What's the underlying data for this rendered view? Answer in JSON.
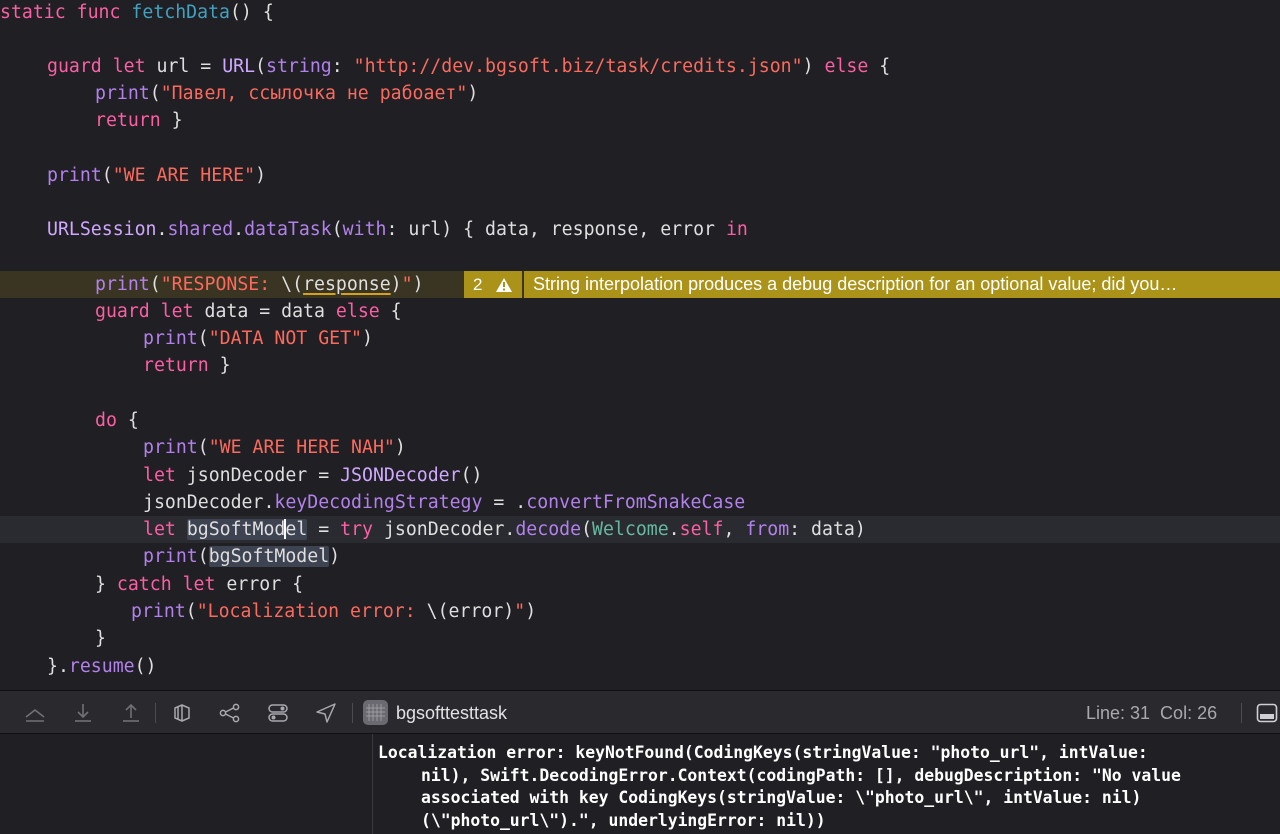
{
  "editor": {
    "lines": {
      "l1": {
        "kw1": "static",
        "kw2": "func",
        "name": "fetchData",
        "rest": "() {"
      },
      "l2": {
        "kw1": "guard",
        "kw2": "let",
        "mid": " url = ",
        "type": "URL",
        "p1": "(",
        "label": "string",
        "p2": ": ",
        "str": "\"http://dev.bgsoft.biz/task/credits.json\"",
        "p3": ") ",
        "kw3": "else",
        "p4": " {"
      },
      "l3": {
        "fn": "print",
        "p1": "(",
        "str": "\"Павел, ссылочка не рабоает\"",
        "p2": ")"
      },
      "l4": {
        "kw": "return",
        "rest": " }"
      },
      "l5": {
        "fn": "print",
        "p1": "(",
        "str": "\"WE ARE HERE\"",
        "p2": ")"
      },
      "l6": {
        "type": "URLSession",
        "d1": ".",
        "prop1": "shared",
        "d2": ".",
        "fn": "dataTask",
        "p1": "(",
        "label": "with",
        "p2": ": url) { data, response, error ",
        "kw": "in"
      },
      "l7": {
        "fn": "print",
        "p1": "(",
        "str1": "\"RESPONSE: ",
        "interp1": "\\(",
        "var": "response",
        "interp2": ")",
        "str2": "\"",
        "p2": ")"
      },
      "l8": {
        "kw1": "guard",
        "kw2": "let",
        "mid": " data = data ",
        "kw3": "else",
        "rest": " {"
      },
      "l9": {
        "fn": "print",
        "p1": "(",
        "str": "\"DATA NOT GET\"",
        "p2": ")"
      },
      "l10": {
        "kw": "return",
        "rest": " }"
      },
      "l11": {
        "kw": "do",
        "rest": " {"
      },
      "l12": {
        "fn": "print",
        "p1": "(",
        "str": "\"WE ARE HERE NAH\"",
        "p2": ")"
      },
      "l13": {
        "kw": "let",
        "mid": " jsonDecoder = ",
        "type": "JSONDecoder",
        "rest": "()"
      },
      "l14": {
        "obj": "jsonDecoder",
        "d1": ".",
        "prop": "keyDecodingStrategy",
        "mid": " = .",
        "val": "convertFromSnakeCase"
      },
      "l15": {
        "kw": "let",
        "sp": " ",
        "var_a": "bgSoftMod",
        "var_b": "el",
        "eq": " = ",
        "kw2": "try",
        "mid": " jsonDecoder.",
        "fn": "decode",
        "p1": "(",
        "type": "Welcome",
        "d1": ".",
        "kw3": "self",
        "p2": ", ",
        "label": "from",
        "p3": ": data)"
      },
      "l16": {
        "fn": "print",
        "p1": "(",
        "var": "bgSoftModel",
        "p2": ")"
      },
      "l17": {
        "p0": "} ",
        "kw1": "catch",
        "sp": " ",
        "kw2": "let",
        "rest": " error {"
      },
      "l18": {
        "fn": "print",
        "p1": "(",
        "str1": "\"Localization error: ",
        "interp": "\\(error)",
        "str2": "\"",
        "p2": ")"
      },
      "l19": {
        "rest": "}"
      },
      "l20": {
        "p0": "}.",
        "fn": "resume",
        "rest": "()"
      }
    },
    "warning": {
      "count": "2",
      "message": "String interpolation produces a debug description for an optional value; did you…"
    }
  },
  "toolbar": {
    "scheme": "bgsofttesttask",
    "position": "Line: 31  Col: 26"
  },
  "console": {
    "lines": [
      "Localization error: keyNotFound(CodingKeys(stringValue: \"photo_url\", intValue:",
      "nil), Swift.DecodingError.Context(codingPath: [], debugDescription: \"No value",
      "associated with key CodingKeys(stringValue: \\\"photo_url\\\", intValue: nil)",
      "(\\\"photo_url\\\").\", underlyingError: nil))"
    ]
  },
  "colors": {
    "background": "#1f1f24",
    "keyword": "#fc5fa3",
    "string": "#fc6a5d",
    "function": "#67b7a4",
    "type": "#d0a8ff",
    "warning": "#ab9319"
  }
}
